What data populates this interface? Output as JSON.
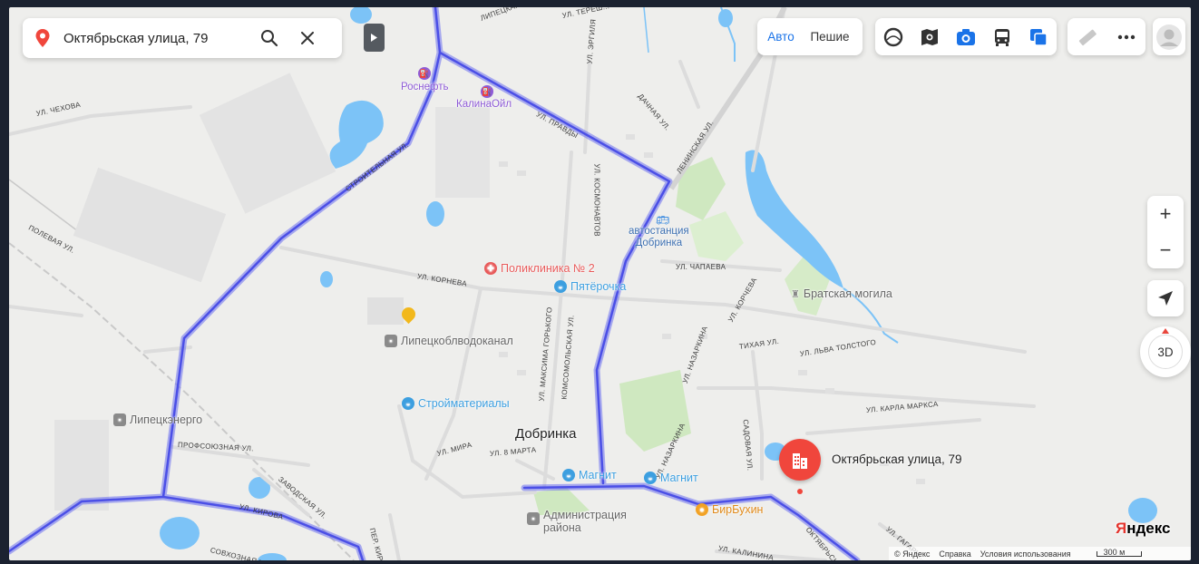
{
  "search": {
    "value": "Октябрьская улица, 79"
  },
  "transport_modes": {
    "car": "Авто",
    "walk": "Пешие"
  },
  "layers": [
    "panorama-icon",
    "photos-icon",
    "camera-icon",
    "bus-icon",
    "layers-icon"
  ],
  "tools": [
    "ruler-icon",
    "more-icon"
  ],
  "zoom": {
    "in": "+",
    "out": "−"
  },
  "view3d": "3D",
  "city": "Добринка",
  "streets": {
    "chekhova": "УЛ. ЧЕХОВА",
    "stroitelnaya": "СТРОИТЕЛЬНАЯ УЛ.",
    "pravdy": "УЛ. ПРАВДЫ",
    "leninskaya": "ЛЕНИНСКАЯ УЛ.",
    "polevaya": "ПОЛЕВАЯ УЛ.",
    "korneva": "УЛ. КОРНЕВА",
    "chapaeva": "УЛ. ЧАПАЕВА",
    "kosmonavtov": "УЛ. КОСМОНАВТОВ",
    "ergilya": "УЛ. ЭРГИЛЯ",
    "dachnaya": "ДАЧНАЯ УЛ.",
    "lipetskaya": "ЛИПЕЦКАЯ УЛ.",
    "tereshkovoy": "УЛ. ТЕРЕШ...",
    "korcheva": "УЛ. КОРЧЕВА",
    "tikhaya": "ТИХАЯ УЛ.",
    "lva_tolstogo": "УЛ. ЛЬВА ТОЛСТОГО",
    "nazarkina1": "УЛ. НАЗАРКИНА",
    "nazarkina2": "УЛ. НАЗАРКИНА",
    "gorkogo": "УЛ. МАКСИМА ГОРЬКОГО",
    "komsomolskaya": "КОМСОМОЛЬСКАЯ УЛ.",
    "karla_marksa": "УЛ. КАРЛА МАРКСА",
    "sadovaya": "САДОВАЯ УЛ.",
    "profsoyuznaya": "ПРОФСОЮЗНАЯ УЛ.",
    "zavodskaya": "ЗАВОДСКАЯ УЛ.",
    "kirova": "УЛ. КИРОВА",
    "mira": "УЛ. МИРА",
    "march8": "УЛ. 8 МАРТА",
    "kirova_per": "ПЕР. КИРОВА",
    "sovkhoznaya": "СОВХОЗНАЯ УЛ.",
    "kalinina": "УЛ. КАЛИНИНА",
    "gagarina": "УЛ. ГАГАРИ...",
    "oktyabrskaya": "ОКТЯБРЬСКАЯ"
  },
  "pois": {
    "rosneft": "Роснефть",
    "kalinaoil": "КалинаОйл",
    "avtostantsiya_1": "автостанция",
    "avtostantsiya_2": "Добринка",
    "poliklinika": "Поликлиника № 2",
    "pyaterochka": "Пятёрочка",
    "bratskaya": "Братская могила",
    "lipetskoblvodokanal": "Липецкоблводоканал",
    "stroymaterialy": "Стройматериалы",
    "lipetskenergo": "Липецкэнерго",
    "magnit1": "Магнит",
    "magnit2": "Магнит",
    "administratsiya_1": "Администрация",
    "administratsiya_2": "района",
    "birbukhin": "БирБухин"
  },
  "marker": {
    "label": "Октябрьская улица, 79"
  },
  "footer": {
    "copyright": "© Яндекс",
    "help": "Справка",
    "terms": "Условия использования",
    "scale": "300 м",
    "logo": "Яндекс"
  },
  "colors": {
    "route": "#5a5ef0",
    "water": "#7cc3f7",
    "green": "#cfe8c0",
    "accent": "#1a73e8",
    "marker": "#f0463c",
    "poi_purple": "#8e5bd6",
    "poi_red": "#e85a5a",
    "poi_blue": "#3c9fe0",
    "poi_orange": "#f2a224",
    "poi_gray": "#8a8a8a"
  }
}
